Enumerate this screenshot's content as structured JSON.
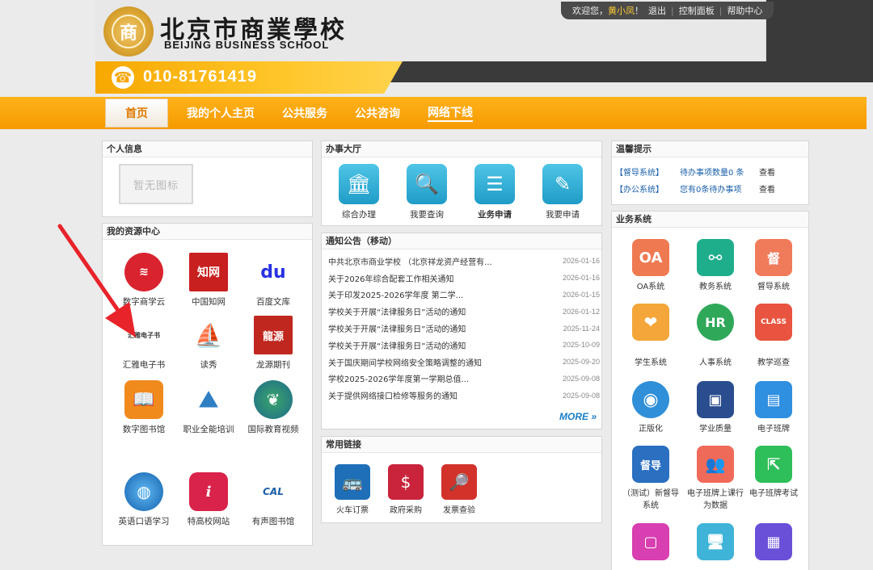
{
  "header": {
    "school_cn": "北京市商業學校",
    "school_en": "BEIJING BUSINESS SCHOOL",
    "phone": "010-81761419",
    "welcome": "欢迎您，",
    "user_name": "黄小凤",
    "welcome_suffix": "！",
    "logout": "退出",
    "control_panel": "控制面板",
    "help_center": "帮助中心"
  },
  "nav": {
    "items": [
      {
        "label": "首页"
      },
      {
        "label": "我的个人主页"
      },
      {
        "label": "公共服务"
      },
      {
        "label": "公共咨询"
      },
      {
        "label": "网络下线"
      }
    ]
  },
  "personal": {
    "title": "个人信息",
    "no_pic": "暂无图标"
  },
  "resources": {
    "title": "我的资源中心",
    "items": [
      {
        "label": "数字商学云"
      },
      {
        "label": "中国知网",
        "glyph": "知网"
      },
      {
        "label": "百度文库",
        "glyph": "du"
      },
      {
        "label": "汇雅电子书",
        "glyph": "汇雅电子书"
      },
      {
        "label": "读秀"
      },
      {
        "label": "龙源期刊",
        "glyph": "龍源"
      },
      {
        "label": "数字图书馆"
      },
      {
        "label": "职业全能培训"
      },
      {
        "label": "国际教育视频"
      },
      {
        "label": "英语口语学习"
      },
      {
        "label": "特高校网站",
        "glyph": "i"
      },
      {
        "label": "有声图书馆",
        "glyph": "CAL"
      }
    ]
  },
  "hall": {
    "title": "办事大厅",
    "items": [
      {
        "label": "综合办理"
      },
      {
        "label": "我要查询"
      },
      {
        "label": "业务申请"
      },
      {
        "label": "我要申请"
      }
    ]
  },
  "notices": {
    "title": "通知公告（移动）",
    "more": "MORE",
    "rows": [
      {
        "title": "中共北京市商业学校 （北京祥龙资产经营有...",
        "date": "2026-01-16"
      },
      {
        "title": "关于2026年综合配套工作相关通知",
        "date": "2026-01-16"
      },
      {
        "title": "关于印发2025-2026学年度 第二学...",
        "date": "2026-01-15"
      },
      {
        "title": "学校关于开展“法律服务日”活动的通知",
        "date": "2026-01-12"
      },
      {
        "title": "学校关于开展“法律服务日”活动的通知",
        "date": "2025-11-24"
      },
      {
        "title": "学校关于开展“法律服务日”活动的通知",
        "date": "2025-10-09"
      },
      {
        "title": "关于国庆期间学校网络安全策略调整的通知",
        "date": "2025-09-20"
      },
      {
        "title": "学校2025-2026学年度第一学期总值...",
        "date": "2025-09-08"
      },
      {
        "title": "关于提供网络接口检修等服务的通知",
        "date": "2025-09-08"
      }
    ]
  },
  "links": {
    "title": "常用链接",
    "items": [
      {
        "label": "火车订票"
      },
      {
        "label": "政府采购"
      },
      {
        "label": "发票查验"
      }
    ]
  },
  "tips": {
    "title": "温馨提示",
    "rows": [
      {
        "system": "【督导系统】",
        "message": "待办事项数量0 条",
        "view": "查看"
      },
      {
        "system": "【办公系统】",
        "message": "您有0条待办事项",
        "view": "查看"
      }
    ]
  },
  "business": {
    "title": "业务系统",
    "items": [
      {
        "label": "OA系统",
        "glyph": "OA"
      },
      {
        "label": "教务系统"
      },
      {
        "label": "督导系统",
        "glyph": "督"
      },
      {
        "label": "学生系统"
      },
      {
        "label": "人事系统",
        "glyph": "HR"
      },
      {
        "label": "教学巡查",
        "glyph": "CLASS"
      },
      {
        "label": "正版化"
      },
      {
        "label": "学业质量"
      },
      {
        "label": "电子班牌"
      },
      {
        "label": "（测试）新督导系统",
        "glyph": "督导"
      },
      {
        "label": "电子班牌上课行为数据"
      },
      {
        "label": "电子班牌考试"
      },
      {
        "label": ""
      },
      {
        "label": ""
      },
      {
        "label": ""
      }
    ]
  },
  "colors": {
    "orange": "#f7a300",
    "blue_tile": "#1f9cc7",
    "link_blue": "#1a5fa8"
  }
}
